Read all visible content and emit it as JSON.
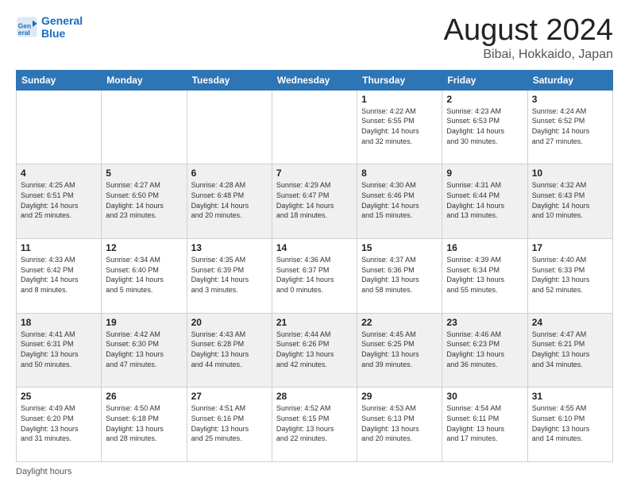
{
  "logo": {
    "line1": "General",
    "line2": "Blue"
  },
  "title": "August 2024",
  "subtitle": "Bibai, Hokkaido, Japan",
  "days_of_week": [
    "Sunday",
    "Monday",
    "Tuesday",
    "Wednesday",
    "Thursday",
    "Friday",
    "Saturday"
  ],
  "footer_label": "Daylight hours",
  "weeks": [
    [
      {
        "day": "",
        "info": ""
      },
      {
        "day": "",
        "info": ""
      },
      {
        "day": "",
        "info": ""
      },
      {
        "day": "",
        "info": ""
      },
      {
        "day": "1",
        "info": "Sunrise: 4:22 AM\nSunset: 6:55 PM\nDaylight: 14 hours\nand 32 minutes."
      },
      {
        "day": "2",
        "info": "Sunrise: 4:23 AM\nSunset: 6:53 PM\nDaylight: 14 hours\nand 30 minutes."
      },
      {
        "day": "3",
        "info": "Sunrise: 4:24 AM\nSunset: 6:52 PM\nDaylight: 14 hours\nand 27 minutes."
      }
    ],
    [
      {
        "day": "4",
        "info": "Sunrise: 4:25 AM\nSunset: 6:51 PM\nDaylight: 14 hours\nand 25 minutes."
      },
      {
        "day": "5",
        "info": "Sunrise: 4:27 AM\nSunset: 6:50 PM\nDaylight: 14 hours\nand 23 minutes."
      },
      {
        "day": "6",
        "info": "Sunrise: 4:28 AM\nSunset: 6:48 PM\nDaylight: 14 hours\nand 20 minutes."
      },
      {
        "day": "7",
        "info": "Sunrise: 4:29 AM\nSunset: 6:47 PM\nDaylight: 14 hours\nand 18 minutes."
      },
      {
        "day": "8",
        "info": "Sunrise: 4:30 AM\nSunset: 6:46 PM\nDaylight: 14 hours\nand 15 minutes."
      },
      {
        "day": "9",
        "info": "Sunrise: 4:31 AM\nSunset: 6:44 PM\nDaylight: 14 hours\nand 13 minutes."
      },
      {
        "day": "10",
        "info": "Sunrise: 4:32 AM\nSunset: 6:43 PM\nDaylight: 14 hours\nand 10 minutes."
      }
    ],
    [
      {
        "day": "11",
        "info": "Sunrise: 4:33 AM\nSunset: 6:42 PM\nDaylight: 14 hours\nand 8 minutes."
      },
      {
        "day": "12",
        "info": "Sunrise: 4:34 AM\nSunset: 6:40 PM\nDaylight: 14 hours\nand 5 minutes."
      },
      {
        "day": "13",
        "info": "Sunrise: 4:35 AM\nSunset: 6:39 PM\nDaylight: 14 hours\nand 3 minutes."
      },
      {
        "day": "14",
        "info": "Sunrise: 4:36 AM\nSunset: 6:37 PM\nDaylight: 14 hours\nand 0 minutes."
      },
      {
        "day": "15",
        "info": "Sunrise: 4:37 AM\nSunset: 6:36 PM\nDaylight: 13 hours\nand 58 minutes."
      },
      {
        "day": "16",
        "info": "Sunrise: 4:39 AM\nSunset: 6:34 PM\nDaylight: 13 hours\nand 55 minutes."
      },
      {
        "day": "17",
        "info": "Sunrise: 4:40 AM\nSunset: 6:33 PM\nDaylight: 13 hours\nand 52 minutes."
      }
    ],
    [
      {
        "day": "18",
        "info": "Sunrise: 4:41 AM\nSunset: 6:31 PM\nDaylight: 13 hours\nand 50 minutes."
      },
      {
        "day": "19",
        "info": "Sunrise: 4:42 AM\nSunset: 6:30 PM\nDaylight: 13 hours\nand 47 minutes."
      },
      {
        "day": "20",
        "info": "Sunrise: 4:43 AM\nSunset: 6:28 PM\nDaylight: 13 hours\nand 44 minutes."
      },
      {
        "day": "21",
        "info": "Sunrise: 4:44 AM\nSunset: 6:26 PM\nDaylight: 13 hours\nand 42 minutes."
      },
      {
        "day": "22",
        "info": "Sunrise: 4:45 AM\nSunset: 6:25 PM\nDaylight: 13 hours\nand 39 minutes."
      },
      {
        "day": "23",
        "info": "Sunrise: 4:46 AM\nSunset: 6:23 PM\nDaylight: 13 hours\nand 36 minutes."
      },
      {
        "day": "24",
        "info": "Sunrise: 4:47 AM\nSunset: 6:21 PM\nDaylight: 13 hours\nand 34 minutes."
      }
    ],
    [
      {
        "day": "25",
        "info": "Sunrise: 4:49 AM\nSunset: 6:20 PM\nDaylight: 13 hours\nand 31 minutes."
      },
      {
        "day": "26",
        "info": "Sunrise: 4:50 AM\nSunset: 6:18 PM\nDaylight: 13 hours\nand 28 minutes."
      },
      {
        "day": "27",
        "info": "Sunrise: 4:51 AM\nSunset: 6:16 PM\nDaylight: 13 hours\nand 25 minutes."
      },
      {
        "day": "28",
        "info": "Sunrise: 4:52 AM\nSunset: 6:15 PM\nDaylight: 13 hours\nand 22 minutes."
      },
      {
        "day": "29",
        "info": "Sunrise: 4:53 AM\nSunset: 6:13 PM\nDaylight: 13 hours\nand 20 minutes."
      },
      {
        "day": "30",
        "info": "Sunrise: 4:54 AM\nSunset: 6:11 PM\nDaylight: 13 hours\nand 17 minutes."
      },
      {
        "day": "31",
        "info": "Sunrise: 4:55 AM\nSunset: 6:10 PM\nDaylight: 13 hours\nand 14 minutes."
      }
    ]
  ]
}
